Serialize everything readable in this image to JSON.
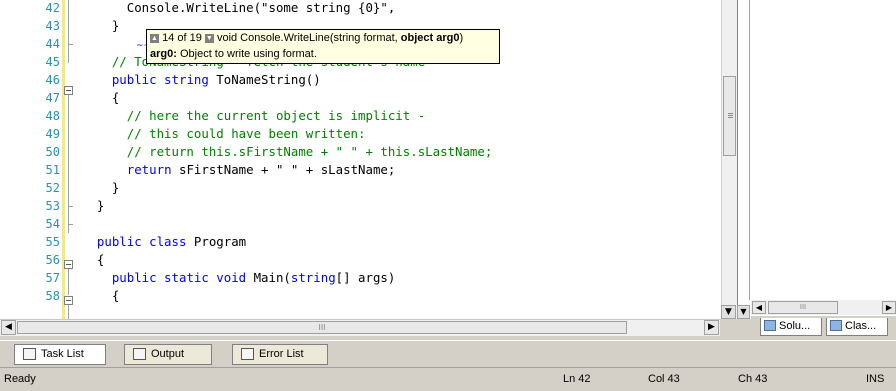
{
  "editor": {
    "lines": [
      {
        "num": "42",
        "parts": [
          {
            "t": "      Console.WriteLine(\"some string {0}\",",
            "c": ""
          }
        ]
      },
      {
        "num": "43",
        "parts": [
          {
            "t": "    }",
            "c": ""
          }
        ]
      },
      {
        "num": "44",
        "parts": [
          {
            "t": "",
            "c": ""
          }
        ]
      },
      {
        "num": "45",
        "parts": [
          {
            "t": "    // ToNameString - fetch the student's name",
            "c": "cm"
          }
        ]
      },
      {
        "num": "46",
        "parts": [
          {
            "t": "    ",
            "c": ""
          },
          {
            "t": "public string",
            "c": "kw"
          },
          {
            "t": " ToNameString()",
            "c": ""
          }
        ]
      },
      {
        "num": "47",
        "parts": [
          {
            "t": "    {",
            "c": ""
          }
        ]
      },
      {
        "num": "48",
        "parts": [
          {
            "t": "      // here the current object is implicit -",
            "c": "cm"
          }
        ]
      },
      {
        "num": "49",
        "parts": [
          {
            "t": "      // this could have been written:",
            "c": "cm"
          }
        ]
      },
      {
        "num": "50",
        "parts": [
          {
            "t": "      // return this.sFirstName + \" \" + this.sLastName;",
            "c": "cm"
          }
        ]
      },
      {
        "num": "51",
        "parts": [
          {
            "t": "      ",
            "c": ""
          },
          {
            "t": "return",
            "c": "kw"
          },
          {
            "t": " sFirstName + \" \" + sLastName;",
            "c": ""
          }
        ]
      },
      {
        "num": "52",
        "parts": [
          {
            "t": "    }",
            "c": ""
          }
        ]
      },
      {
        "num": "53",
        "parts": [
          {
            "t": "  }",
            "c": ""
          }
        ]
      },
      {
        "num": "54",
        "parts": [
          {
            "t": "",
            "c": ""
          }
        ]
      },
      {
        "num": "55",
        "parts": [
          {
            "t": "  ",
            "c": ""
          },
          {
            "t": "public class",
            "c": "kw"
          },
          {
            "t": " Program",
            "c": ""
          }
        ]
      },
      {
        "num": "56",
        "parts": [
          {
            "t": "  {",
            "c": ""
          }
        ]
      },
      {
        "num": "57",
        "parts": [
          {
            "t": "    ",
            "c": ""
          },
          {
            "t": "public static void",
            "c": "kw"
          },
          {
            "t": " Main(",
            "c": ""
          },
          {
            "t": "string",
            "c": "kw"
          },
          {
            "t": "[] args)",
            "c": ""
          }
        ]
      },
      {
        "num": "58",
        "parts": [
          {
            "t": "    {",
            "c": ""
          }
        ]
      }
    ]
  },
  "tooltip": {
    "counter": "14 of 19",
    "signature_prefix": " void Console.WriteLine(string format, ",
    "signature_bold": "object arg0",
    "signature_suffix": ")",
    "param_name": "arg0:",
    "param_desc": " Object to write using format."
  },
  "right_panel": {
    "tabs": [
      {
        "label": "Solu..."
      },
      {
        "label": "Clas..."
      }
    ]
  },
  "bottom_tabs": [
    {
      "label": "Task List"
    },
    {
      "label": "Output"
    },
    {
      "label": "Error List"
    }
  ],
  "status": {
    "text": "Ready",
    "ln": "Ln 42",
    "col": "Col 43",
    "ch": "Ch 43",
    "mode": "INS"
  },
  "scroll_glyph": "III"
}
